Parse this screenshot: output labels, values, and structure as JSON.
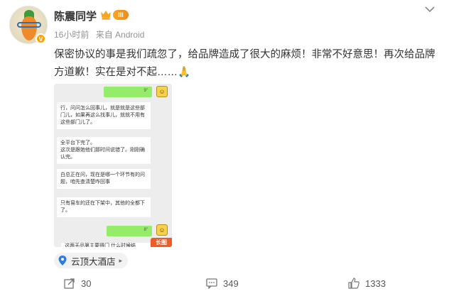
{
  "post": {
    "author": "陈震同学",
    "level": "III",
    "time": "16小时前",
    "source": "来自 Android",
    "text": "保密协议的事是我们疏忽了，给品牌造成了很大的麻烦！非常不好意思！再次给品牌方道歉！实在是对不起……",
    "clap": "🙏"
  },
  "screenshot": {
    "msg1": "行，问问怎么回事儿，就是就是这些部门儿，如果再这么找事儿，就就不用有这些部门儿了。",
    "msg2": "全平台下完了。\n这次是跟她他们那时间说错了。刚刚确认完。",
    "msg3": "白总正在问，现在是哪一个环节有的问题，咱先查清楚咋回事",
    "msg4": "只有易车的还在下架中，其他的全都下了。",
    "green1": "9\"",
    "green2": "8\"",
    "bottom_cut": "这两天品第主要得门 什么时候结",
    "long_label": "长图"
  },
  "location": {
    "label": "云顶大酒店"
  },
  "actions": {
    "share": "30",
    "comment": "349",
    "like": "1333"
  },
  "colors": {
    "accent": "#f7a400",
    "bubble_green": "#95ec69",
    "long_badge": "#f05a24"
  }
}
